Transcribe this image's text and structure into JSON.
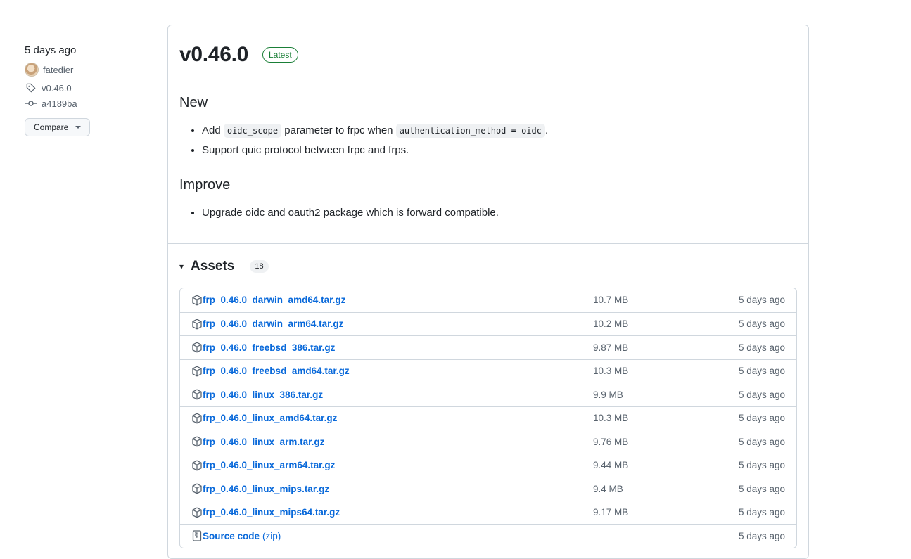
{
  "sidebar": {
    "time": "5 days ago",
    "author": "fatedier",
    "tag": "v0.46.0",
    "commit": "a4189ba",
    "compare_label": "Compare"
  },
  "release": {
    "title": "v0.46.0",
    "badge": "Latest",
    "sections": [
      {
        "title": "New",
        "items": [
          {
            "prefix": "Add ",
            "code1": "oidc_scope",
            "mid": " parameter to frpc when ",
            "code2": "authentication_method = oidc",
            "suffix": "."
          },
          {
            "text": "Support quic protocol between frpc and frps."
          }
        ]
      },
      {
        "title": "Improve",
        "items": [
          {
            "text": "Upgrade oidc and oauth2 package which is forward compatible."
          }
        ]
      }
    ]
  },
  "assets": {
    "toggle": "▾",
    "title": "Assets",
    "count": "18",
    "rows": [
      {
        "name": "frp_0.46.0_darwin_amd64.tar.gz",
        "size": "10.7 MB",
        "date": "5 days ago"
      },
      {
        "name": "frp_0.46.0_darwin_arm64.tar.gz",
        "size": "10.2 MB",
        "date": "5 days ago"
      },
      {
        "name": "frp_0.46.0_freebsd_386.tar.gz",
        "size": "9.87 MB",
        "date": "5 days ago"
      },
      {
        "name": "frp_0.46.0_freebsd_amd64.tar.gz",
        "size": "10.3 MB",
        "date": "5 days ago"
      },
      {
        "name": "frp_0.46.0_linux_386.tar.gz",
        "size": "9.9 MB",
        "date": "5 days ago"
      },
      {
        "name": "frp_0.46.0_linux_amd64.tar.gz",
        "size": "10.3 MB",
        "date": "5 days ago"
      },
      {
        "name": "frp_0.46.0_linux_arm.tar.gz",
        "size": "9.76 MB",
        "date": "5 days ago"
      },
      {
        "name": "frp_0.46.0_linux_arm64.tar.gz",
        "size": "9.44 MB",
        "date": "5 days ago"
      },
      {
        "name": "frp_0.46.0_linux_mips.tar.gz",
        "size": "9.4 MB",
        "date": "5 days ago"
      },
      {
        "name": "frp_0.46.0_linux_mips64.tar.gz",
        "size": "9.17 MB",
        "date": "5 days ago"
      }
    ],
    "source": {
      "name": "Source code",
      "suffix": "(zip)",
      "date": "5 days ago"
    }
  }
}
